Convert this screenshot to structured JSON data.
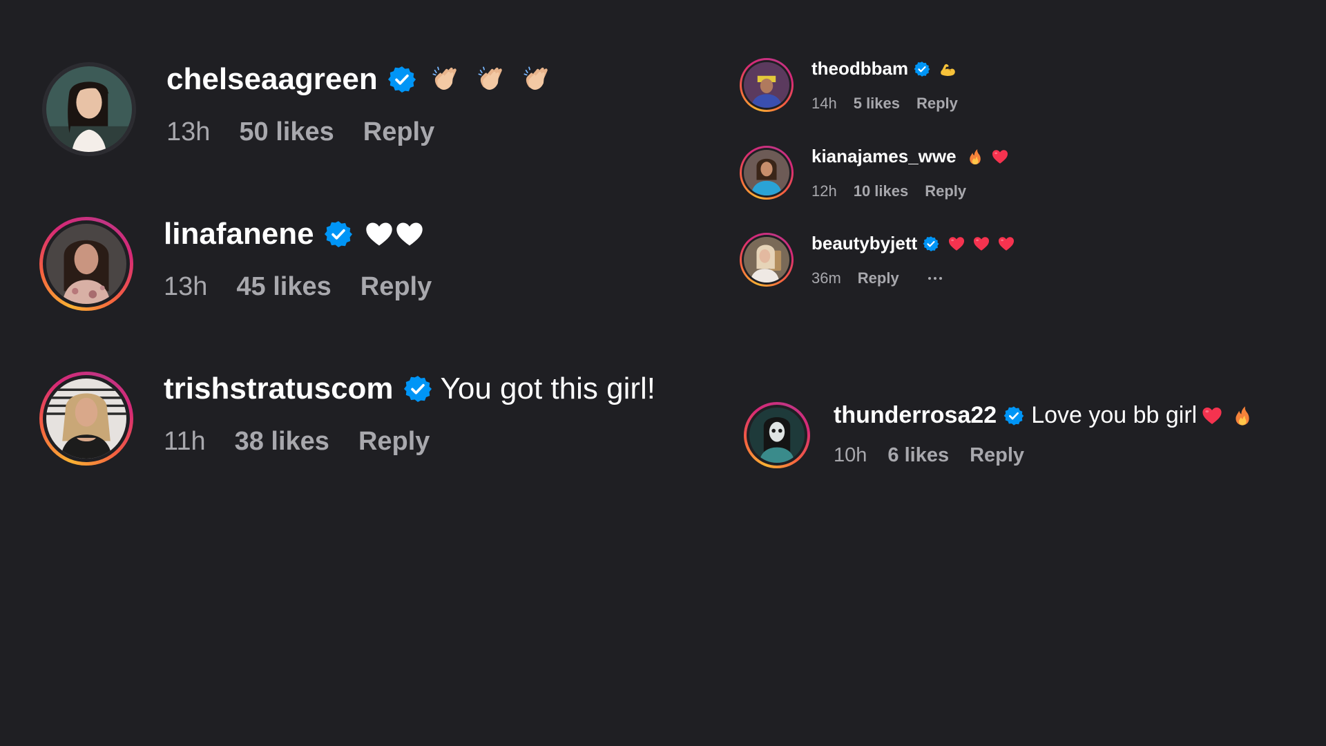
{
  "colors": {
    "background": "#1f1f23",
    "text": "#ffffff",
    "meta": "#a8a8ad",
    "verified": "#0095f6",
    "story_ring": [
      "#f9b233",
      "#f56040",
      "#d62976",
      "#c13584"
    ]
  },
  "comments_left": [
    {
      "username": "chelseaagreen",
      "verified": true,
      "text": "",
      "emojis": [
        "clapping-hands",
        "clapping-hands",
        "clapping-hands"
      ],
      "time": "13h",
      "likes": "50 likes",
      "reply": "Reply",
      "story_ring": false
    },
    {
      "username": "linafanene",
      "verified": true,
      "text": "",
      "emojis": [
        "white-heart",
        "white-heart"
      ],
      "time": "13h",
      "likes": "45 likes",
      "reply": "Reply",
      "story_ring": true
    },
    {
      "username": "trishstratuscom",
      "verified": true,
      "text": "You got this girl!",
      "emojis": [],
      "time": "11h",
      "likes": "38 likes",
      "reply": "Reply",
      "story_ring": true
    }
  ],
  "comments_right": [
    {
      "username": "theodbbam",
      "verified": true,
      "text": "",
      "emojis": [
        "flexed-biceps"
      ],
      "time": "14h",
      "likes": "5 likes",
      "reply": "Reply",
      "story_ring": true
    },
    {
      "username": "kianajames_wwe",
      "verified": false,
      "text": "",
      "emojis": [
        "fire",
        "red-heart"
      ],
      "time": "12h",
      "likes": "10 likes",
      "reply": "Reply",
      "story_ring": true
    },
    {
      "username": "beautybyjett",
      "verified": true,
      "text": "",
      "emojis": [
        "red-heart",
        "red-heart",
        "red-heart"
      ],
      "time": "36m",
      "likes": "",
      "reply": "Reply",
      "more_icon": "more-horizontal-icon",
      "story_ring": true
    },
    {
      "username": "thunderrosa22",
      "verified": true,
      "text": "Love you bb girl",
      "emojis": [
        "red-heart",
        "fire"
      ],
      "time": "10h",
      "likes": "6 likes",
      "reply": "Reply",
      "story_ring": true
    }
  ]
}
